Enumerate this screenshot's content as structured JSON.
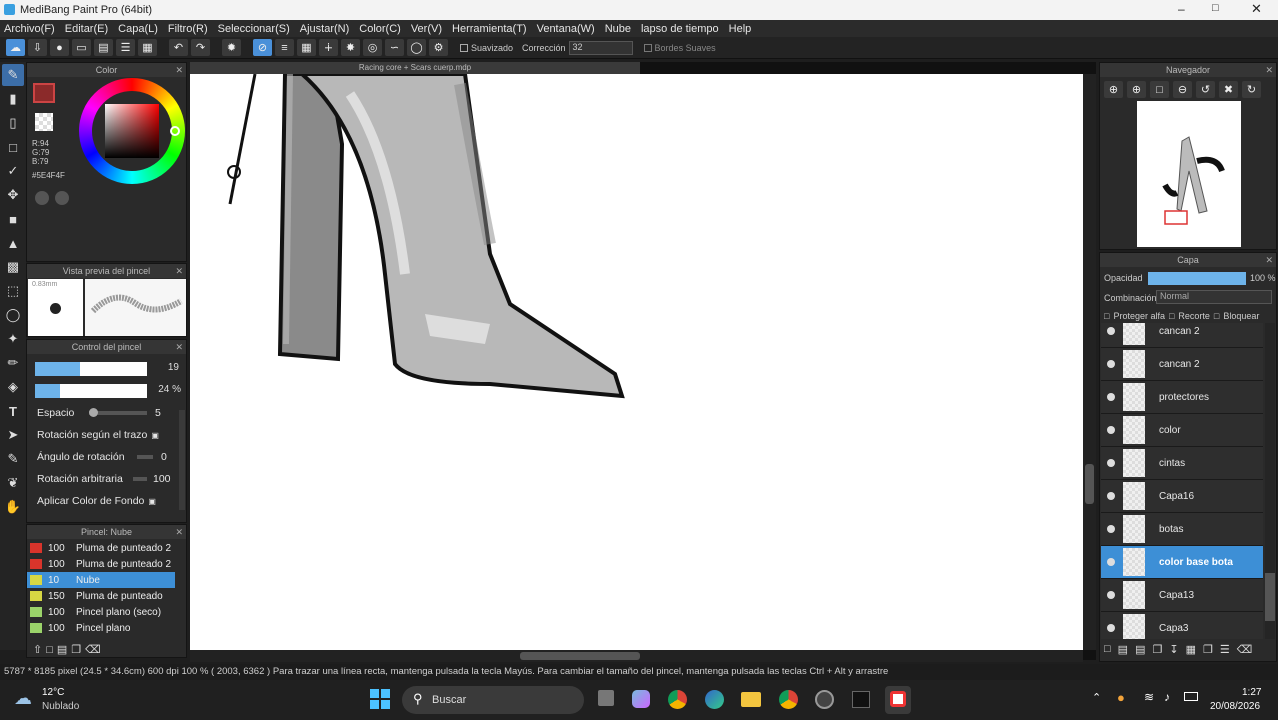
{
  "title": "MediBang Paint Pro (64bit)",
  "menu": [
    "Archivo(F)",
    "Editar(E)",
    "Capa(L)",
    "Filtro(R)",
    "Seleccionar(S)",
    "Ajustar(N)",
    "Color(C)",
    "Ver(V)",
    "Herramienta(T)",
    "Ventana(W)",
    "Nube",
    "lapso de tiempo",
    "Help"
  ],
  "toolbar": {
    "smooth_label": "Suavizado",
    "correction_label": "Corrección",
    "correction_value": "32",
    "soft_edges_label": "Bordes Suaves"
  },
  "color_panel": {
    "title": "Color",
    "r": "R:94",
    "g": "G:79",
    "b": "B:79",
    "hex": "#5E4F4F",
    "primary": "#8b2a2a"
  },
  "brush_preview": {
    "title": "Vista previa del pincel",
    "size": "0.83mm"
  },
  "brush_control": {
    "title": "Control del pincel",
    "size_value": "19",
    "opacity_value": "24 %",
    "spacing_label": "Espacio",
    "spacing_value": "5",
    "rotation_stroke_label": "Rotación según el trazo",
    "rotation_angle_label": "Ángulo de rotación",
    "rotation_angle_value": "0",
    "random_rotation_label": "Rotación arbitraria",
    "random_rotation_value": "100",
    "bg_color_label": "Aplicar Color de Fondo"
  },
  "brush_list": {
    "title": "Pincel: Nube",
    "items": [
      {
        "size": "100",
        "name": "Pluma de punteado 2",
        "color": "#d9342b"
      },
      {
        "size": "100",
        "name": "Pluma de punteado 2",
        "color": "#d9342b"
      },
      {
        "size": "10",
        "name": "Nube",
        "color": "#d7d743"
      },
      {
        "size": "150",
        "name": "Pluma de punteado",
        "color": "#d7d743"
      },
      {
        "size": "100",
        "name": "Pincel plano (seco)",
        "color": "#9bd36a"
      },
      {
        "size": "100",
        "name": "Pincel plano",
        "color": "#9bd36a"
      }
    ],
    "selected": 2
  },
  "document_tab": "Racing core + Scars cuerp.mdp",
  "navigator": {
    "title": "Navegador"
  },
  "layers": {
    "title": "Capa",
    "opacity_label": "Opacidad",
    "opacity_value": "100 %",
    "blend_label": "Combinación",
    "blend_value": "Normal",
    "protect_alpha": "Proteger alfa",
    "clip": "Recorte",
    "lock": "Bloquear",
    "items": [
      "cancan 2",
      "cancan 2",
      "protectores",
      "color",
      "cintas",
      "Capa16",
      "botas",
      "color base bota",
      "Capa13",
      "Capa3"
    ],
    "selected": 7
  },
  "status": "5787 * 8185 pixel   (24.5 * 34.6cm)   600 dpi   100 %   ( 2003, 6362 )   Para trazar una línea recta, mantenga pulsada la tecla Mayús. Para cambiar el tamaño del pincel, mantenga pulsada las teclas Ctrl + Alt y arrastre",
  "taskbar": {
    "temp": "12°C",
    "weather": "Nublado",
    "search": "Buscar",
    "time": "1:27",
    "date": "20/08/2026"
  }
}
